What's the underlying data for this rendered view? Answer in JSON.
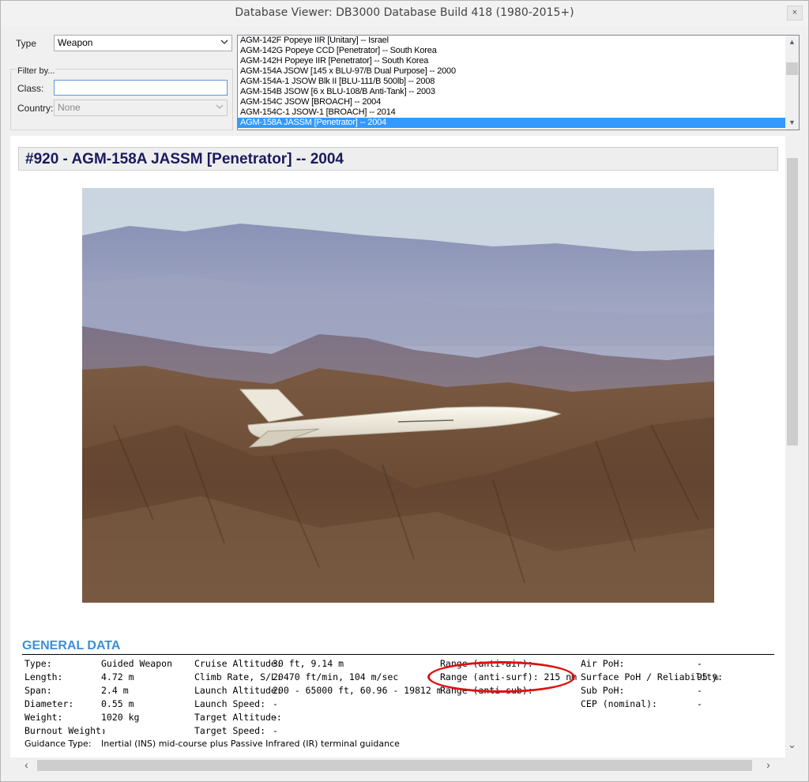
{
  "window": {
    "title": "Database Viewer: DB3000 Database Build 418 (1980-2015+)",
    "close_label": "×"
  },
  "filters": {
    "type_label": "Type",
    "type_value": "Weapon",
    "filter_by_label": "Filter by...",
    "class_label": "Class:",
    "class_value": "",
    "country_label": "Country:",
    "country_value": "None"
  },
  "list": {
    "items": [
      {
        "label": "AGM-142F Popeye IIR [Unitary] -- Israel",
        "selected": false
      },
      {
        "label": "AGM-142G Popeye CCD [Penetrator] -- South Korea",
        "selected": false
      },
      {
        "label": "AGM-142H Popeye IIR [Penetrator] -- South Korea",
        "selected": false
      },
      {
        "label": "AGM-154A JSOW [145 x BLU-97/B Dual Purpose] -- 2000",
        "selected": false
      },
      {
        "label": "AGM-154A-1 JSOW Blk II [BLU-111/B 500lb] -- 2008",
        "selected": false
      },
      {
        "label": "AGM-154B JSOW [6 x BLU-108/B Anti-Tank] -- 2003",
        "selected": false
      },
      {
        "label": "AGM-154C JSOW [BROACH] -- 2004",
        "selected": false
      },
      {
        "label": "AGM-154C-1 JSOW-1 [BROACH] -- 2014",
        "selected": false
      },
      {
        "label": "AGM-158A JASSM [Penetrator] -- 2004",
        "selected": true
      }
    ]
  },
  "detail": {
    "heading": "#920 - AGM-158A JASSM [Penetrator] -- 2004",
    "section_title": "GENERAL DATA",
    "col1": [
      {
        "label": "Type:",
        "value": "Guided Weapon"
      },
      {
        "label": "Length:",
        "value": "4.72 m"
      },
      {
        "label": "Span:",
        "value": "2.4 m"
      },
      {
        "label": "Diameter:",
        "value": "0.55 m"
      },
      {
        "label": "Weight:",
        "value": "1020 kg"
      },
      {
        "label": "Burnout Weight:",
        "value": "-"
      }
    ],
    "col2": [
      {
        "label": "Cruise Altitude:",
        "value": "30 ft, 9.14 m"
      },
      {
        "label": "Climb Rate, S/L:",
        "value": "20470 ft/min, 104 m/sec"
      },
      {
        "label": "Launch Altitude:",
        "value": "200 - 65000 ft, 60.96 - 19812 m"
      },
      {
        "label": "Launch Speed:",
        "value": "-"
      },
      {
        "label": "Target Altitude:",
        "value": "-"
      },
      {
        "label": "Target Speed:",
        "value": "-"
      }
    ],
    "col3": [
      {
        "text": "Range (anti-air):"
      },
      {
        "text": "Range (anti-surf): 215 nm"
      },
      {
        "text": "Range (anti-sub):"
      }
    ],
    "col4": [
      {
        "label": "Air PoH:",
        "value": "-"
      },
      {
        "label": "Surface PoH / Reliability:",
        "value": "95 %"
      },
      {
        "label": "Sub PoH:",
        "value": "-"
      },
      {
        "label": "CEP (nominal):",
        "value": "-"
      }
    ],
    "guidance_label": "Guidance Type:",
    "guidance_value": "Inertial (INS) mid-course plus Passive Infrared (IR) terminal guidance"
  },
  "colors": {
    "selection": "#3399ff",
    "heading": "#1a1a60",
    "section": "#3b8fd8",
    "highlight_circle": "#dd1111"
  },
  "icons": [
    "close-icon",
    "chevron-down-icon",
    "scroll-up-icon",
    "scroll-down-icon",
    "scroll-left-icon",
    "scroll-right-icon"
  ]
}
